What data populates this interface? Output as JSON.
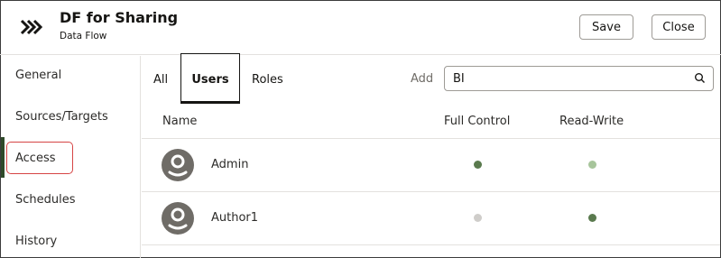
{
  "header": {
    "title": "DF for Sharing",
    "subtitle": "Data Flow",
    "save_label": "Save",
    "close_label": "Close",
    "logo_icon": "chevrons-right-icon"
  },
  "sidebar": {
    "items": [
      {
        "label": "General"
      },
      {
        "label": "Sources/Targets"
      },
      {
        "label": "Access",
        "active": true
      },
      {
        "label": "Schedules"
      },
      {
        "label": "History"
      }
    ]
  },
  "tabs": [
    {
      "label": "All"
    },
    {
      "label": "Users",
      "selected": true
    },
    {
      "label": "Roles"
    }
  ],
  "search": {
    "add_label": "Add",
    "value": "BI",
    "icon": "search-icon"
  },
  "table": {
    "columns": [
      "Name",
      "Full Control",
      "Read-Write"
    ],
    "rows": [
      {
        "name": "Admin",
        "full_control": "checked",
        "read_write": "implied"
      },
      {
        "name": "Author1",
        "full_control": "unchecked",
        "read_write": "checked"
      }
    ]
  },
  "colors": {
    "checked": "#5a7a4e",
    "implied": "#a7c59b",
    "unchecked": "#cfcdca",
    "active_bar": "#2f4a2a",
    "highlight": "#d64545"
  }
}
